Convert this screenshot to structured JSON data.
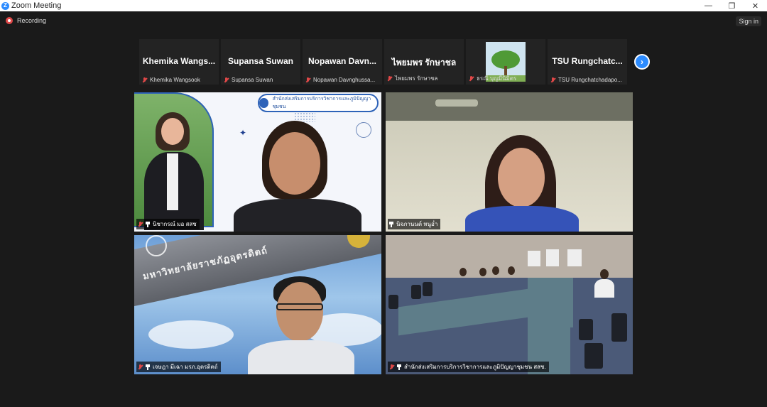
{
  "window": {
    "title": "Zoom Meeting",
    "controls": {
      "minimize": "—",
      "restore": "❐",
      "close": "✕"
    }
  },
  "topbar": {
    "recording": "Recording",
    "sign_in": "Sign in"
  },
  "thumbnails": [
    {
      "display": "Khemika  Wangs...",
      "name": "Khemika Wangsook"
    },
    {
      "display": "Supansa Suwan",
      "name": "Supansa Suwan"
    },
    {
      "display": "Nopawan  Davn...",
      "name": "Nopawan Davnghussa..."
    },
    {
      "display": "ไพยมพร  รักษาชล",
      "name": "ไพยมพร รักษาชล"
    },
    {
      "display": "",
      "name": "ธรณี บุญมีนิมิตร"
    },
    {
      "display": "TSU  Rungchatc...",
      "name": "TSU Rungchatchadapo..."
    }
  ],
  "next_page": "›",
  "tiles": [
    {
      "name": "นิชากรณ์ มอ สสช",
      "banner": "สำนักส่งเสริมการบริการวิชาการและภูมิปัญญาชุมชน"
    },
    {
      "name": "นิจภานนต์ หนูอ่ำ"
    },
    {
      "name": "เจษฎา มีเฉา มรภ.อุตรดิตถ์",
      "sign": "มหาวิทยาลัยราชภัฏอุตรดิตถ์"
    },
    {
      "name": "สำนักส่งเสริมการบริการวิชาการและภูมิปัญญาชุมชน สสช."
    }
  ],
  "icons": {
    "app": "zoom-icon",
    "recording": "record-icon",
    "mic_muted": "mic-muted-icon",
    "pin": "pin-icon",
    "next": "chevron-right-icon"
  },
  "colors": {
    "accent": "#2d8cff",
    "muted_red": "#e04848",
    "background": "#1a1a1a"
  }
}
